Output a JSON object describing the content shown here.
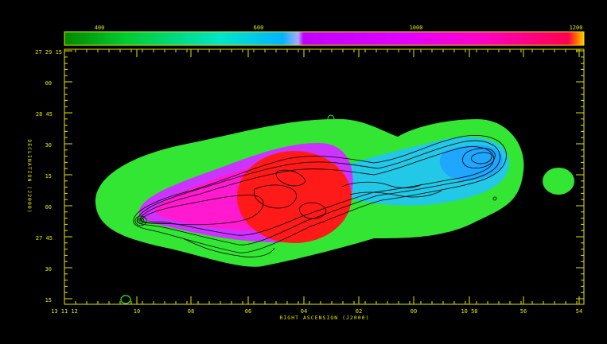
{
  "chart_data": {
    "type": "heatmap",
    "title": "",
    "xlabel": "RIGHT ASCENSION (J2000)",
    "ylabel": "DECLINATION (J2000)",
    "colorbar": {
      "tick_labels": [
        "400",
        "600",
        "1000",
        "1200"
      ],
      "colors": [
        "#00cc00",
        "#00e6b8",
        "#00b4ff",
        "#c000ff",
        "#ff00c8",
        "#ff0050"
      ]
    },
    "x_tick_labels": [
      "13 11 12",
      "10",
      "08",
      "06",
      "04",
      "02",
      "00",
      "10 58",
      "56",
      "54"
    ],
    "y_tick_labels": [
      "27 29 15",
      "00",
      "28 45",
      "30",
      "15",
      "00",
      "27 45",
      "30",
      "15"
    ],
    "grid": false,
    "overlay": "contours",
    "colors": {
      "frame": "#e6e600",
      "background": "#000000",
      "contour": "#000000",
      "low": "#33e633",
      "mid": "#22aaff",
      "high": "#ff1a1a",
      "edge": "#cc33ff"
    }
  }
}
